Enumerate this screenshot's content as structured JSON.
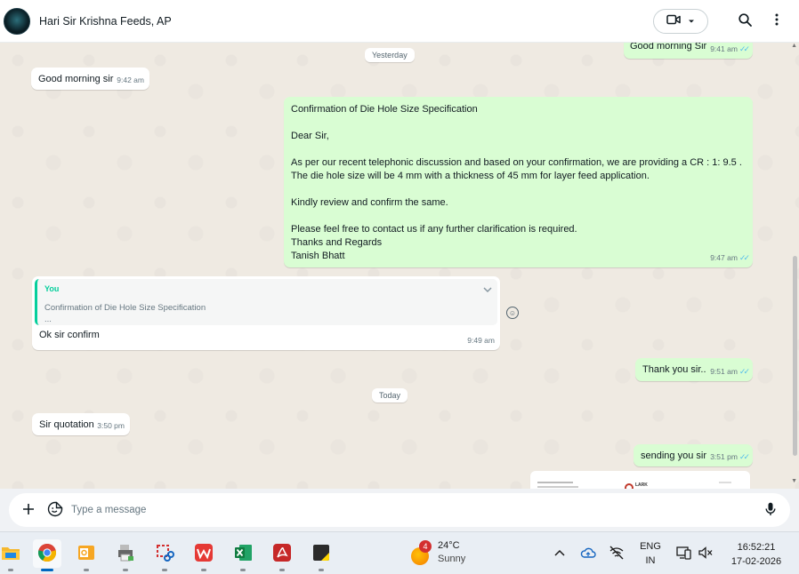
{
  "header": {
    "contact_name": "Hari Sir Krishna Feeds, AP"
  },
  "chat": {
    "day_yesterday": "Yesterday",
    "day_today": "Today",
    "m1": {
      "text": "Good morning Sir",
      "time": "9:41 am"
    },
    "m2": {
      "text": "Good morning sir",
      "time": "9:42 am"
    },
    "m3": {
      "lines": [
        "Confirmation of Die Hole Size Specification",
        "",
        "Dear Sir,",
        "",
        "As per our recent telephonic discussion and based on your confirmation, we are providing a CR : 1: 9.5  .",
        "The die hole size will be 4 mm with a thickness of 45 mm for layer feed application.",
        "",
        "Kindly review and confirm the same.",
        "",
        "Please feel free to contact us if any further clarification is required.",
        "Thanks and Regards",
        "Tanish Bhatt"
      ],
      "time": "9:47 am"
    },
    "m4": {
      "quote_author": "You",
      "quote_text": "Confirmation of Die Hole Size Specification",
      "quote_more": "...",
      "text": "Ok sir confirm",
      "time": "9:49 am"
    },
    "m5": {
      "text": "Thank you sir..",
      "time": "9:51 am"
    },
    "m6": {
      "text": "Sir quotation",
      "time": "3:50 pm"
    },
    "m7": {
      "text": "sending you sir",
      "time": "3:51 pm"
    },
    "doc_preview": {
      "brand": "LARK"
    }
  },
  "compose": {
    "placeholder": "Type a message"
  },
  "taskbar": {
    "weather": {
      "temp": "24°C",
      "condition": "Sunny",
      "badge": "4"
    },
    "lang": {
      "line1": "ENG",
      "line2": "IN"
    },
    "clock": {
      "time": "16:52:21",
      "date": "17-02-2026"
    }
  },
  "colors": {
    "outgoing_bubble": "#d9fdd3",
    "incoming_bubble": "#ffffff",
    "read_ticks": "#53bdeb",
    "quote_accent": "#06cf9c",
    "chat_background": "#efeae2"
  },
  "icons": [
    "video-call-icon",
    "chevron-down-icon",
    "search-icon",
    "menu-dots-icon",
    "plus-icon",
    "emoji-sticker-icon",
    "mic-icon",
    "reaction-emoji-icon"
  ]
}
